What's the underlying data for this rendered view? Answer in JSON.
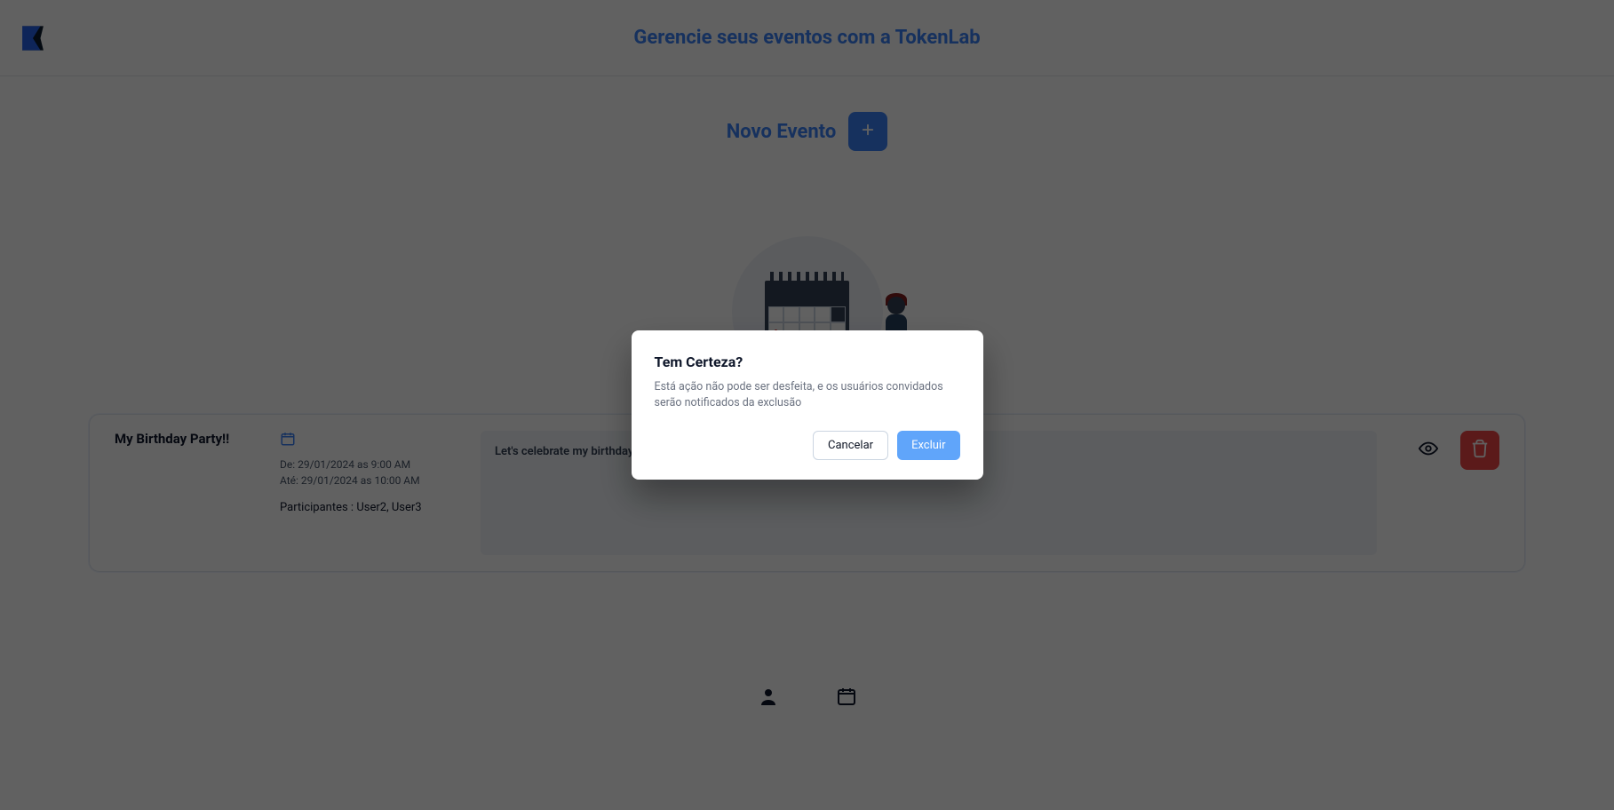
{
  "header": {
    "title": "Gerencie seus eventos com a TokenLab"
  },
  "new_event": {
    "label": "Novo Evento"
  },
  "event": {
    "title": "My Birthday Party!!",
    "from_label": "De:",
    "from_value": "29/01/2024 as 9:00 AM",
    "to_label": "Até:",
    "to_value": "29/01/2024 as 10:00 AM",
    "participants_label": "Participantes :",
    "participants_value": "User2, User3",
    "description": "Let's celebrate my birthday at the bar!!"
  },
  "dialog": {
    "title": "Tem Certeza?",
    "body": "Está ação não pode ser desfeita, e os usuários convidados serão notificados da exclusão",
    "cancel": "Cancelar",
    "confirm": "Excluir"
  }
}
